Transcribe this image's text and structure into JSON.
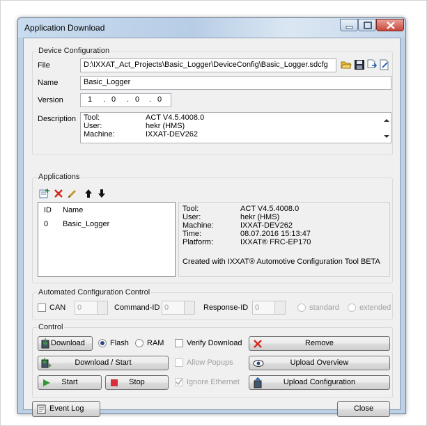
{
  "window": {
    "title": "Application Download"
  },
  "device_config": {
    "legend": "Device Configuration",
    "file_label": "File",
    "file_value": "D:\\IXXAT_Act_Projects\\Basic_Logger\\DeviceConfig\\Basic_Logger.sdcfg",
    "name_label": "Name",
    "name_value": "Basic_Logger",
    "version_label": "Version",
    "version_parts": [
      "1",
      "0",
      "0",
      "0"
    ],
    "version_sep": ".",
    "description_label": "Description",
    "description_rows": [
      {
        "key": "Tool:",
        "value": "ACT V4.5.4008.0"
      },
      {
        "key": "User:",
        "value": "hekr (HMS)"
      },
      {
        "key": "Machine:",
        "value": "IXXAT-DEV262"
      }
    ]
  },
  "applications": {
    "legend": "Applications",
    "columns": [
      "ID",
      "Name"
    ],
    "rows": [
      {
        "id": "0",
        "name": "Basic_Logger"
      }
    ],
    "info_rows": [
      {
        "key": "Tool:",
        "value": "ACT V4.5.4008.0"
      },
      {
        "key": "User:",
        "value": "hekr (HMS)"
      },
      {
        "key": "Machine:",
        "value": "IXXAT-DEV262"
      },
      {
        "key": "Time:",
        "value": "08.07.2016 15:13:47"
      },
      {
        "key": "Platform:",
        "value": "IXXAT® FRC-EP170"
      }
    ],
    "created_text": "Created with IXXAT® Automotive Configuration Tool BETA"
  },
  "acc": {
    "legend": "Automated Configuration Control",
    "can_label": "CAN",
    "can_value": "0",
    "command_label": "Command-ID",
    "command_value": "0",
    "response_label": "Response-ID",
    "response_value": "0",
    "standard_label": "standard",
    "extended_label": "extended"
  },
  "control": {
    "legend": "Control",
    "download_label": "Download",
    "flash_label": "Flash",
    "ram_label": "RAM",
    "verify_label": "Verify Download",
    "remove_label": "Remove",
    "download_start_label": "Download / Start",
    "allow_popups_label": "Allow Popups",
    "upload_overview_label": "Upload Overview",
    "start_label": "Start",
    "stop_label": "Stop",
    "ignore_ethernet_label": "Ignore Ethernet",
    "upload_config_label": "Upload Configuration"
  },
  "footer": {
    "event_log_label": "Event Log",
    "close_label": "Close"
  }
}
